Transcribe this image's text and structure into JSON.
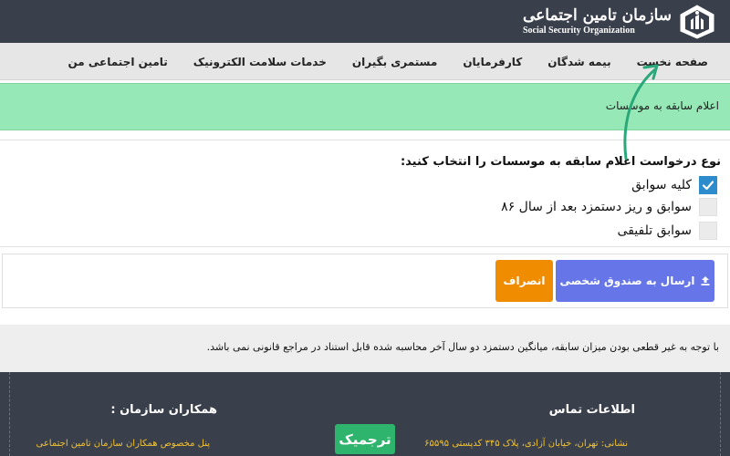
{
  "header": {
    "org_name_fa": "سازمان تامین اجتماعی",
    "org_name_en": "Social Security Organization",
    "logo_icon": "ssa-emblem-icon"
  },
  "nav": {
    "items": [
      {
        "label": "صفحه نخست"
      },
      {
        "label": "بیمه شدگان"
      },
      {
        "label": "کارفرمایان"
      },
      {
        "label": "مستمری بگیران"
      },
      {
        "label": "خدمات سلامت الکترونیک"
      },
      {
        "label": "تامین اجتماعی من"
      }
    ]
  },
  "banner": {
    "text": "اعلام سابقه به موسسات"
  },
  "form": {
    "title": "نوع درخواست اعلام سابقه به موسسات را انتخاب کنید:",
    "options": [
      {
        "label": "کلیه سوابق",
        "checked": true
      },
      {
        "label": "سوابق و ریز دستمزد بعد از سال ۸۶",
        "checked": false
      },
      {
        "label": "سوابق تلفیقی",
        "checked": false
      }
    ],
    "send_button": "ارسال به صندوق شخصی",
    "cancel_button": "انصراف"
  },
  "note": {
    "text": "با توجه به غیر قطعی بودن میزان سابقه، میانگین دستمزد دو سال آخر محاسبه شده قابل استناد در مراجع قانونی نمی باشد."
  },
  "footer": {
    "contact_title": "اطلاعات تماس",
    "partners_title": "همکاران سازمان :",
    "address": "نشانی: تهران، خیابان آزادی، پلاک ۳۴۵ کدپستی ۶۵۵۹۵",
    "partners_link": "پنل مخصوص همکاران سازمان تامین اجتماعی"
  },
  "watermark": {
    "text": "ترجمیک"
  },
  "colors": {
    "header_bg": "#3a3f4c",
    "nav_bg": "#e6e6e6",
    "banner_bg": "#96e8b6",
    "send_button": "#6676e8",
    "cancel_button": "#f08c00",
    "checkbox_checked": "#2e8bcc",
    "footer_link": "#f2c230",
    "watermark_bg": "#2fb46e",
    "annotation_arrow": "#2aa87a"
  }
}
